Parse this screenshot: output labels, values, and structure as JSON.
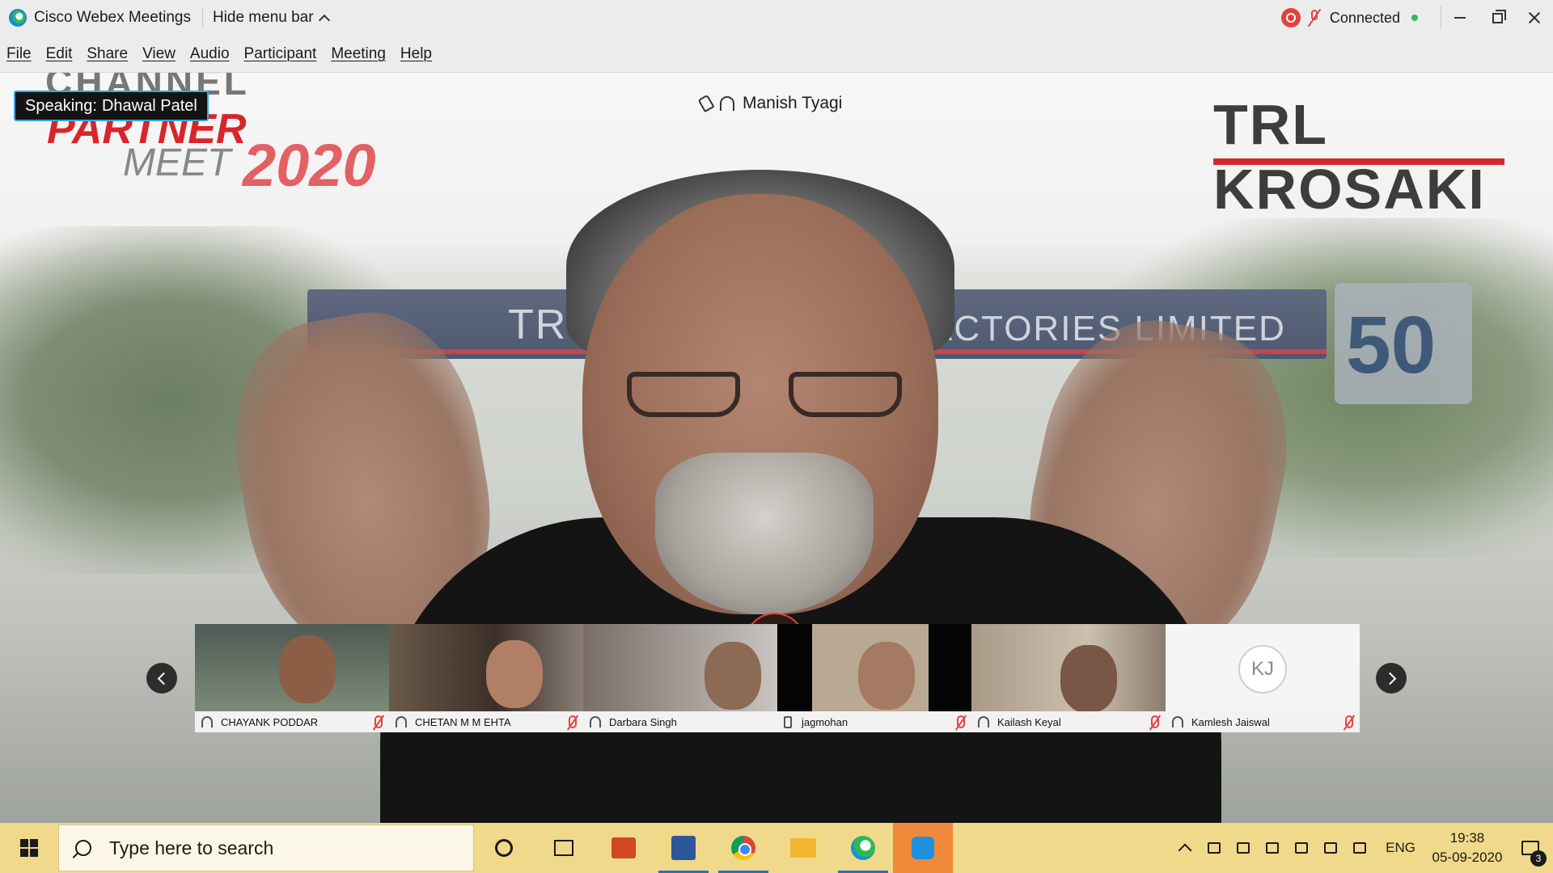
{
  "window": {
    "app_title": "Cisco Webex Meetings",
    "hide_menu_label": "Hide menu bar",
    "status_label": "Connected"
  },
  "menu": [
    "File",
    "Edit",
    "Share",
    "View",
    "Audio",
    "Participant",
    "Meeting",
    "Help"
  ],
  "stage": {
    "speaking_prefix": "Speaking:",
    "speaking_name": "Dhawal Patel",
    "active_participant": "Manish Tyagi",
    "backdrop": {
      "logo_left": [
        "CHANNEL",
        "PARTNER",
        "MEET",
        "2020"
      ],
      "logo_right": "TRL KROSAKI",
      "gate_left": "TRL",
      "gate_right": "ACTORIES LIMITED",
      "gate_badge": "50"
    }
  },
  "participants": [
    {
      "name": "CHAYANK PODDAR",
      "audio": "headset",
      "muted": true
    },
    {
      "name": "CHETAN M M EHTA",
      "audio": "headset",
      "muted": true
    },
    {
      "name": "Darbara Singh",
      "audio": "headset",
      "muted": false
    },
    {
      "name": "jagmohan",
      "audio": "phone",
      "muted": true
    },
    {
      "name": "Kailash Keyal",
      "audio": "headset",
      "muted": true
    },
    {
      "name": "Kamlesh Jaiswal",
      "audio": "headset",
      "muted": true,
      "initials": "KJ"
    }
  ],
  "taskbar": {
    "search_placeholder": "Type here to search",
    "language": "ENG",
    "time": "19:38",
    "date": "05-09-2020",
    "notification_count": "3"
  },
  "colors": {
    "accent_blue": "#36a7e6",
    "mute_red": "#e5413a",
    "connected_green": "#2fb85a",
    "taskbar": "#f0d98a"
  }
}
